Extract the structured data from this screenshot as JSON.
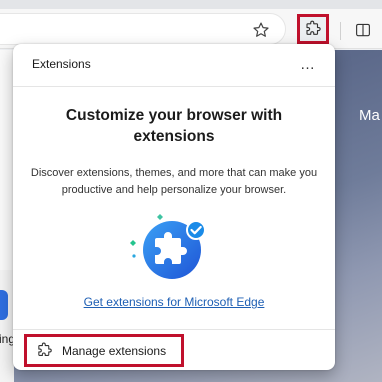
{
  "toolbar": {
    "favorite_icon": "star-icon",
    "extensions_icon": "puzzle-icon",
    "split_icon": "split-screen-icon",
    "highlight_color": "#c0102c"
  },
  "page": {
    "partial_heading": "Ma",
    "partial_label": "ing"
  },
  "extensions_panel": {
    "title": "Extensions",
    "more_label": "…",
    "heading": "Customize your browser with extensions",
    "description": "Discover extensions, themes, and more that can make you productive and help personalize your browser.",
    "get_link": "Get extensions for Microsoft Edge",
    "link_color": "#1e5fb4",
    "manage_label": "Manage extensions"
  }
}
